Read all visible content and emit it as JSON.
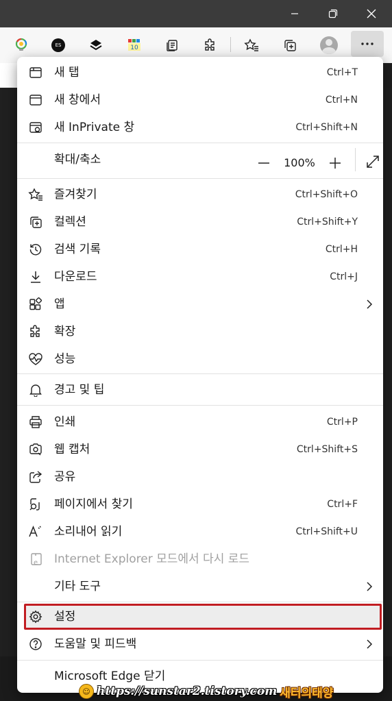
{
  "menu": {
    "new_tab": {
      "label": "새 탭",
      "shortcut": "Ctrl+T"
    },
    "new_window": {
      "label": "새 창에서",
      "shortcut": "Ctrl+N"
    },
    "new_inprivate": {
      "label": "새 InPrivate 창",
      "shortcut": "Ctrl+Shift+N"
    },
    "zoom": {
      "label": "확대/축소",
      "value": "100%"
    },
    "favorites": {
      "label": "즐겨찾기",
      "shortcut": "Ctrl+Shift+O"
    },
    "collections": {
      "label": "컬렉션",
      "shortcut": "Ctrl+Shift+Y"
    },
    "history": {
      "label": "검색 기록",
      "shortcut": "Ctrl+H"
    },
    "downloads": {
      "label": "다운로드",
      "shortcut": "Ctrl+J"
    },
    "apps": {
      "label": "앱"
    },
    "extensions": {
      "label": "확장"
    },
    "performance": {
      "label": "성능"
    },
    "alerts_tips": {
      "label": "경고 및 팁"
    },
    "print": {
      "label": "인쇄",
      "shortcut": "Ctrl+P"
    },
    "web_capture": {
      "label": "웹 캡처",
      "shortcut": "Ctrl+Shift+S"
    },
    "share": {
      "label": "공유"
    },
    "find_on_page": {
      "label": "페이지에서 찾기",
      "shortcut": "Ctrl+F"
    },
    "read_aloud": {
      "label": "소리내어 읽기",
      "shortcut": "Ctrl+Shift+U"
    },
    "ie_mode": {
      "label": "Internet Explorer 모드에서 다시 로드"
    },
    "more_tools": {
      "label": "기타 도구"
    },
    "settings": {
      "label": "설정"
    },
    "help_feedback": {
      "label": "도움말 및 피드백"
    },
    "close_edge": {
      "label": "Microsoft Edge 닫기"
    }
  },
  "toolbar": {
    "es_badge": "ES",
    "ext_badge": "10"
  },
  "watermark": {
    "url": "https://sunstar2.tistory.com",
    "name": "새터의태양"
  },
  "colors": {
    "highlight_border": "#c11d22",
    "menu_bg": "#ffffff",
    "titlebar": "#3b3b3b"
  }
}
